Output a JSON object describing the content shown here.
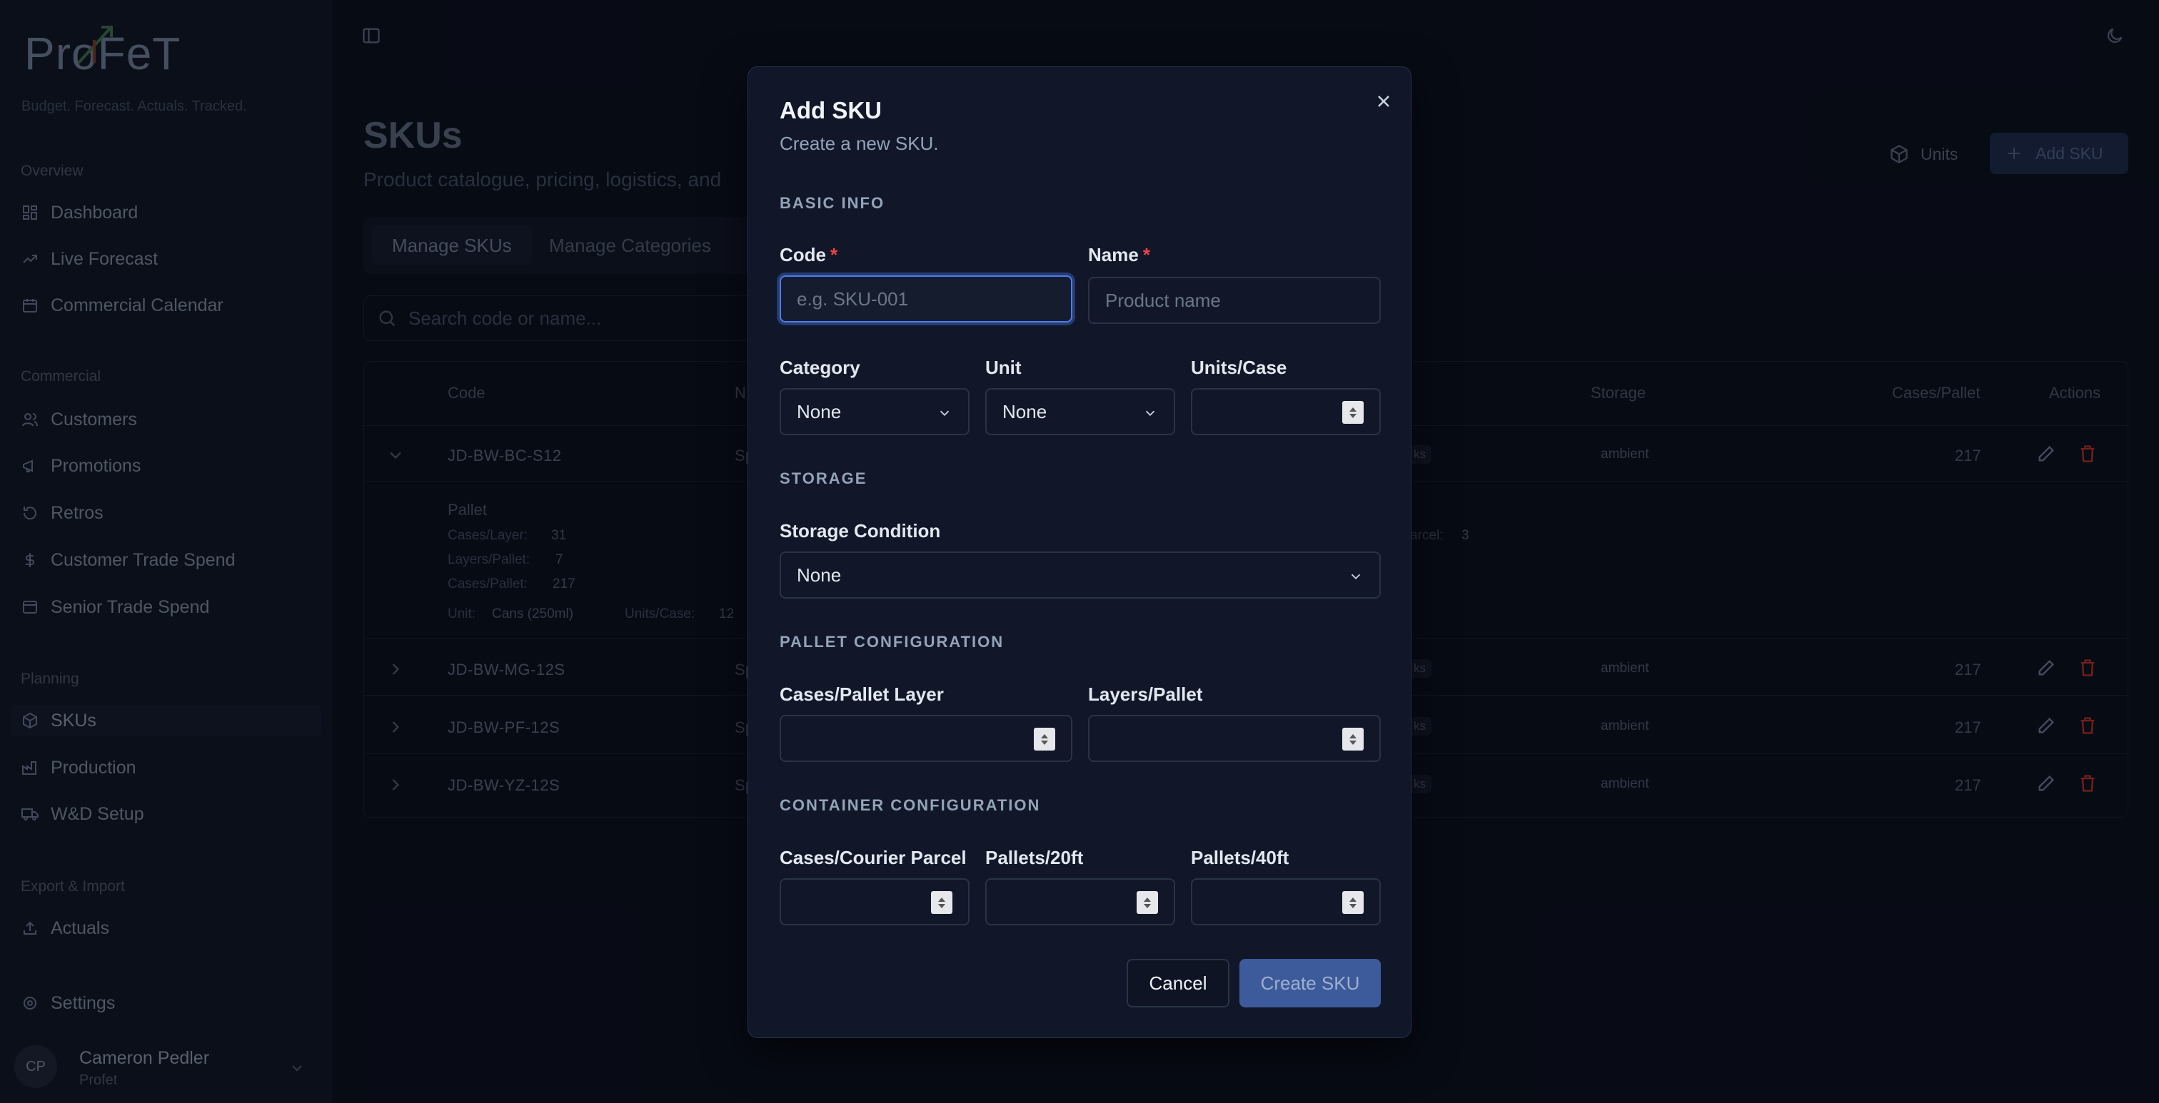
{
  "app": {
    "logo_text": "ProFeT",
    "tagline": "Budget. Forecast. Actuals. Tracked."
  },
  "sidebar": {
    "sections": [
      {
        "title": "Overview",
        "items": [
          {
            "label": "Dashboard",
            "icon": "grid-icon"
          },
          {
            "label": "Live Forecast",
            "icon": "trending-up-icon"
          },
          {
            "label": "Commercial Calendar",
            "icon": "calendar-icon"
          }
        ]
      },
      {
        "title": "Commercial",
        "items": [
          {
            "label": "Customers",
            "icon": "users-icon"
          },
          {
            "label": "Promotions",
            "icon": "megaphone-icon"
          },
          {
            "label": "Retros",
            "icon": "rotate-icon"
          },
          {
            "label": "Customer Trade Spend",
            "icon": "dollar-icon"
          },
          {
            "label": "Senior Trade Spend",
            "icon": "wallet-icon"
          }
        ]
      },
      {
        "title": "Planning",
        "items": [
          {
            "label": "SKUs",
            "icon": "package-icon",
            "active": true
          },
          {
            "label": "Production",
            "icon": "factory-icon"
          },
          {
            "label": "W&D Setup",
            "icon": "truck-icon"
          }
        ]
      },
      {
        "title": "Export & Import",
        "items": [
          {
            "label": "Actuals",
            "icon": "upload-icon"
          }
        ]
      }
    ],
    "settings_label": "Settings",
    "user": {
      "initials": "CP",
      "name": "Cameron Pedler",
      "org": "Profet"
    }
  },
  "page": {
    "title": "SKUs",
    "subtitle": "Product catalogue, pricing, logistics, and",
    "units_button": "Units",
    "add_button": "Add SKU",
    "tabs": [
      "Manage SKUs",
      "Manage Categories"
    ],
    "search_placeholder": "Search code or name...",
    "table": {
      "headers": {
        "code": "Code",
        "name": "N",
        "storage": "Storage",
        "cases_pallet": "Cases/Pallet",
        "actions": "Actions"
      },
      "rows": [
        {
          "code": "JD-BW-BC-S12",
          "name": "Sp",
          "tag": "ks",
          "storage": "ambient",
          "cases_pallet": "217",
          "expanded": true
        },
        {
          "code": "JD-BW-MG-12S",
          "name": "Sp",
          "tag": "ks",
          "storage": "ambient",
          "cases_pallet": "217"
        },
        {
          "code": "JD-BW-PF-12S",
          "name": "Sp",
          "tag": "ks",
          "storage": "ambient",
          "cases_pallet": "217"
        },
        {
          "code": "JD-BW-YZ-12S",
          "name": "Sp",
          "tag": "ks",
          "storage": "ambient",
          "cases_pallet": "217"
        }
      ],
      "detail": {
        "heading": "Pallet",
        "cases_layer_label": "Cases/Layer:",
        "cases_layer": "31",
        "layers_pallet_label": "Layers/Pallet:",
        "layers_pallet": "7",
        "cases_pallet_label": "Cases/Pallet:",
        "cases_pallet": "217",
        "unit_label": "Unit:",
        "unit": "Cans (250ml)",
        "units_case_label": "Units/Case:",
        "units_case": "12",
        "parcel_label": "arcel:",
        "parcel": "3"
      }
    }
  },
  "dialog": {
    "title": "Add SKU",
    "description": "Create a new SKU.",
    "sections": {
      "basic": "BASIC INFO",
      "storage": "STORAGE",
      "pallet": "PALLET CONFIGURATION",
      "container": "CONTAINER CONFIGURATION"
    },
    "fields": {
      "code": {
        "label": "Code",
        "required": "*",
        "placeholder": "e.g. SKU-001"
      },
      "name": {
        "label": "Name",
        "required": "*",
        "placeholder": "Product name"
      },
      "category": {
        "label": "Category",
        "value": "None"
      },
      "unit": {
        "label": "Unit",
        "value": "None"
      },
      "units_case": {
        "label": "Units/Case"
      },
      "storage_condition": {
        "label": "Storage Condition",
        "value": "None"
      },
      "cases_pallet_layer": {
        "label": "Cases/Pallet Layer"
      },
      "layers_pallet": {
        "label": "Layers/Pallet"
      },
      "cases_courier_parcel": {
        "label": "Cases/Courier Parcel"
      },
      "pallets_20ft": {
        "label": "Pallets/20ft"
      },
      "pallets_40ft": {
        "label": "Pallets/40ft"
      }
    },
    "cancel_label": "Cancel",
    "create_label": "Create SKU"
  },
  "colors": {
    "focus_ring": "#4c7df0",
    "primary_button": "#3d5a9b",
    "delete_icon": "#b4312f",
    "required": "#ef4444"
  }
}
